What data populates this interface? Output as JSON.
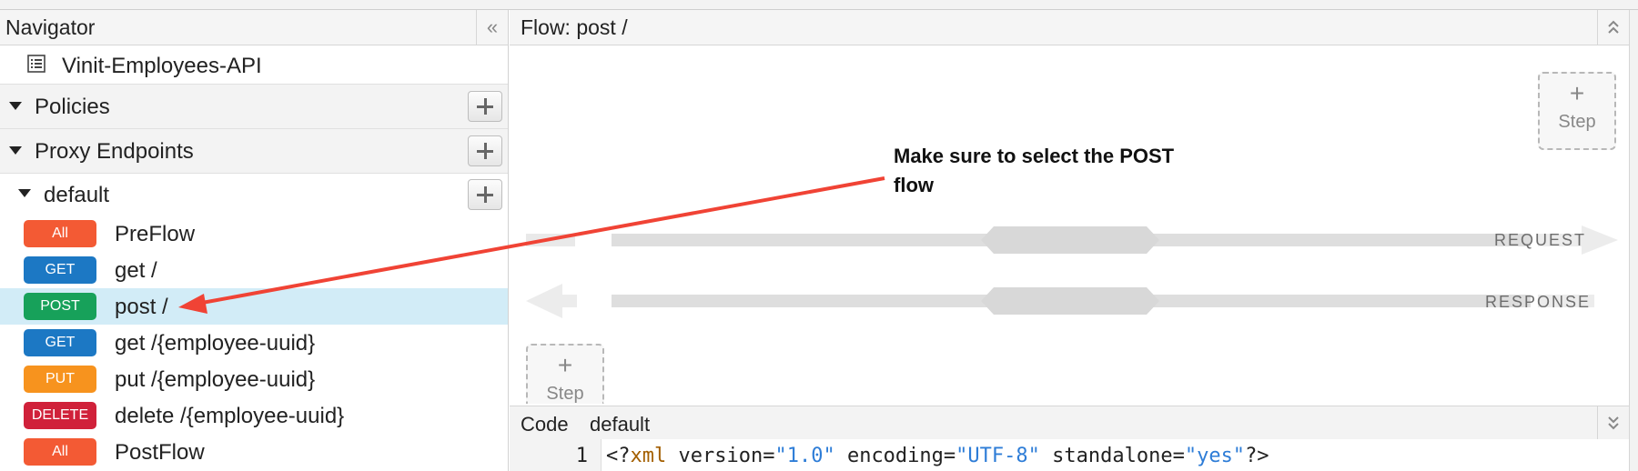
{
  "navigator": {
    "title": "Navigator",
    "collapse_glyph": "«",
    "api_name": "Vinit-Employees-API",
    "sections": [
      {
        "label": "Policies"
      },
      {
        "label": "Proxy Endpoints"
      }
    ],
    "endpoint": {
      "label": "default"
    },
    "flows": [
      {
        "method": "All",
        "color": "#f35a34",
        "label": "PreFlow"
      },
      {
        "method": "GET",
        "color": "#1c78c4",
        "label": "get /"
      },
      {
        "method": "POST",
        "color": "#17a15a",
        "label": "post /"
      },
      {
        "method": "GET",
        "color": "#1c78c4",
        "label": "get /{employee-uuid}"
      },
      {
        "method": "PUT",
        "color": "#f7931e",
        "label": "put /{employee-uuid}"
      },
      {
        "method": "DELETE",
        "color": "#d0213a",
        "label": "delete /{employee-uuid}"
      },
      {
        "method": "All",
        "color": "#f35a34",
        "label": "PostFlow"
      }
    ]
  },
  "flow_panel": {
    "title": "Flow: post /",
    "step_plus": "+",
    "step_label": "Step",
    "request_label": "REQUEST",
    "response_label": "RESPONSE"
  },
  "code_panel": {
    "label": "Code",
    "tab": "default",
    "line_number": "1",
    "code_parts": [
      "<?",
      "xml",
      " version=",
      "\"1.0\"",
      " encoding=",
      "\"UTF-8\"",
      " standalone=",
      "\"yes\"",
      "?>"
    ]
  },
  "annotation": {
    "line1": "Make sure to select the POST",
    "line2": "flow",
    "color": "#f04335"
  }
}
